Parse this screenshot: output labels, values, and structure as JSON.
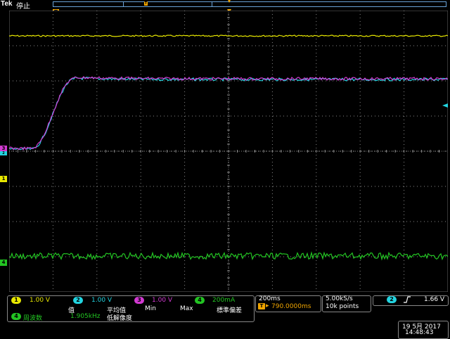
{
  "header": {
    "brand": "Tek",
    "state": "停止",
    "trigger_mark": "T"
  },
  "markers": {
    "ch3": "3",
    "ch2": "2",
    "ch1": "1",
    "ch4": "4"
  },
  "channels": [
    {
      "num": "1",
      "scale": "1.00 V",
      "color": "#e8e800"
    },
    {
      "num": "2",
      "scale": "1.00 V",
      "color": "#22d4e0"
    },
    {
      "num": "3",
      "scale": "1.00 V",
      "color": "#d23ad2"
    },
    {
      "num": "4",
      "scale": "200mA",
      "color": "#22c422"
    }
  ],
  "measure": {
    "headers": [
      "值",
      "平均值",
      "Min",
      "Max",
      "標準偏差"
    ],
    "row": {
      "channel": "4",
      "name": "周波数",
      "value": "1.905kHz",
      "note": "低解像度"
    }
  },
  "timebase": {
    "scale": "200ms",
    "position": "790.0000ms"
  },
  "acquisition": {
    "rate": "5.00kS/s",
    "points": "10k points"
  },
  "trigger": {
    "channel": "2",
    "slope_icon": "rising-edge-icon",
    "level": "1.66 V"
  },
  "datetime": {
    "date": "19 5月  2017",
    "time": "14:48:43"
  }
}
